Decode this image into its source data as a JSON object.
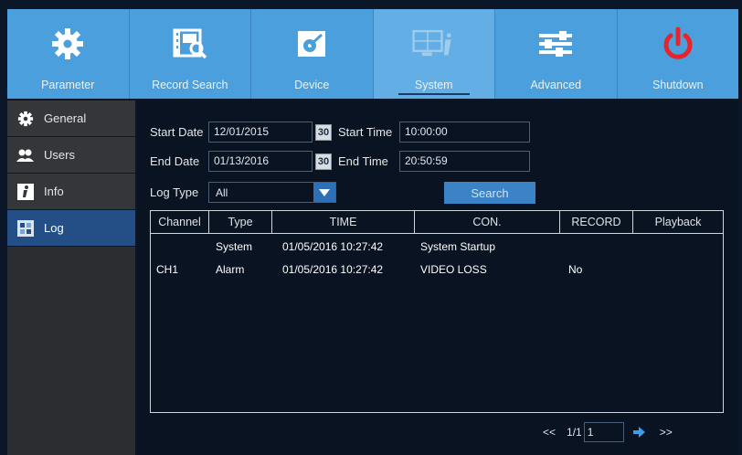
{
  "nav": {
    "tabs": [
      {
        "label": "Parameter",
        "icon": "gear-icon"
      },
      {
        "label": "Record Search",
        "icon": "film-search-icon"
      },
      {
        "label": "Device",
        "icon": "hard-disk-icon"
      },
      {
        "label": "System",
        "icon": "system-info-icon"
      },
      {
        "label": "Advanced",
        "icon": "sliders-icon"
      },
      {
        "label": "Shutdown",
        "icon": "power-icon"
      }
    ],
    "active_tab": "System"
  },
  "sidebar": {
    "items": [
      {
        "label": "General",
        "icon": "gear-icon"
      },
      {
        "label": "Users",
        "icon": "users-icon"
      },
      {
        "label": "Info",
        "icon": "info-icon"
      },
      {
        "label": "Log",
        "icon": "log-icon"
      }
    ],
    "active_item": "Log"
  },
  "form": {
    "start_date_label": "Start Date",
    "start_date": "12/01/2015",
    "start_time_label": "Start Time",
    "start_time": "10:00:00",
    "end_date_label": "End Date",
    "end_date": "01/13/2016",
    "end_time_label": "End Time",
    "end_time": "20:50:59",
    "calendar_glyph": "30",
    "log_type_label": "Log Type",
    "log_type": "All",
    "search_label": "Search"
  },
  "table": {
    "columns": [
      "Channel",
      "Type",
      "TIME",
      "CON.",
      "RECORD",
      "Playback"
    ],
    "rows": [
      {
        "channel": "",
        "type": "System",
        "time": "01/05/2016 10:27:42",
        "con": "System Startup",
        "record": "",
        "playback": ""
      },
      {
        "channel": "CH1",
        "type": "Alarm",
        "time": "01/05/2016 10:27:42",
        "con": "VIDEO LOSS",
        "record": "No",
        "playback": ""
      }
    ]
  },
  "pager": {
    "prev": "<<",
    "page_info": "1/1",
    "page_input": "1",
    "next": ">>"
  },
  "colors": {
    "nav_bg": "#4a9fdc",
    "active_sidebar": "#244f86",
    "accent": "#2e6fb6",
    "shutdown_red": "#e8232a"
  }
}
